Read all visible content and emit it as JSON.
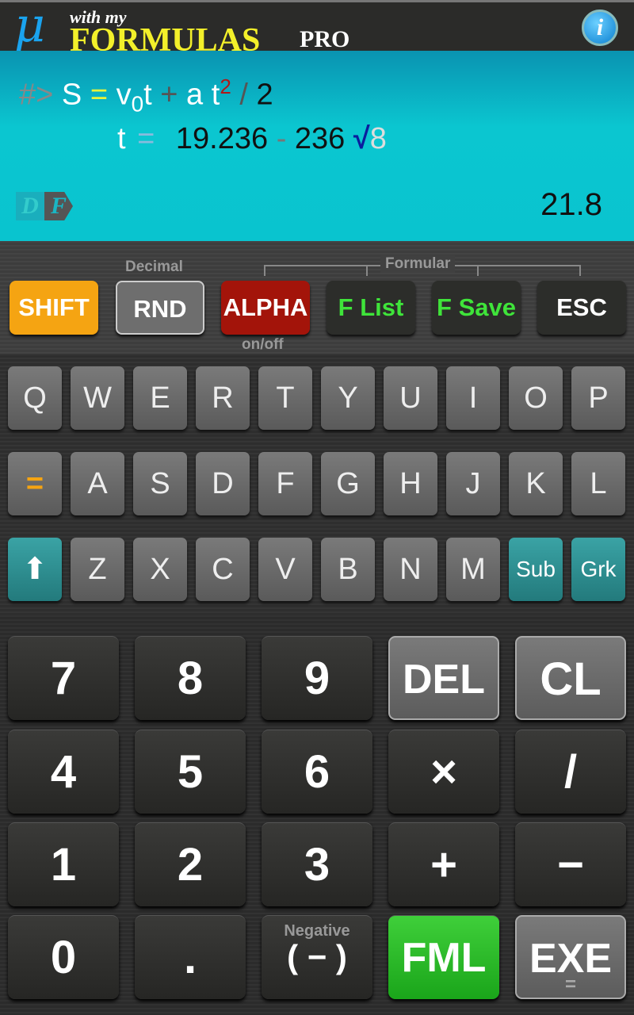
{
  "header": {
    "logo_mu": "μ",
    "logo_with": "with my",
    "logo_formulas": "FORMULAS",
    "logo_pro": "PRO",
    "info": "i"
  },
  "display": {
    "prompt": "#>",
    "formula": {
      "S": "S",
      "eq": "=",
      "v": "v",
      "sub0": "0",
      "t1": "t",
      "plus": "+",
      "a": "a",
      "t2": "t",
      "sup": "2",
      "slash": "/",
      "two": "2"
    },
    "input": {
      "var": "t",
      "eq": "=",
      "n1": "19.236",
      "minus": "-",
      "n2": "236",
      "sqrt": "√",
      "n3": "8"
    },
    "mode_d": "D",
    "mode_f": "F",
    "result": "21.8"
  },
  "function_row": {
    "label_decimal": "Decimal",
    "label_formular": "Formular",
    "label_onoff": "on/off",
    "buttons": [
      {
        "label": "SHIFT",
        "bg": "#f5a412",
        "color": "#ffffff"
      },
      {
        "label": "RND",
        "bg": "#6e6e6e",
        "color": "#ffffff"
      },
      {
        "label": "ALPHA",
        "bg": "#a3140a",
        "color": "#ffffff"
      },
      {
        "label": "F List",
        "bg": "#2c2d2a",
        "color": "#3fe43a"
      },
      {
        "label": "F Save",
        "bg": "#2c2d2a",
        "color": "#3fe43a"
      },
      {
        "label": "ESC",
        "bg": "#2c2d2a",
        "color": "#ffffff"
      }
    ]
  },
  "letters": [
    [
      "Q",
      "W",
      "E",
      "R",
      "T",
      "Y",
      "U",
      "I",
      "O",
      "P"
    ],
    [
      "=",
      "A",
      "S",
      "D",
      "F",
      "G",
      "H",
      "J",
      "K",
      "L"
    ],
    [
      "⬆",
      "Z",
      "X",
      "C",
      "V",
      "B",
      "N",
      "M",
      "Sub",
      "Grk"
    ]
  ],
  "numpad": [
    [
      "7",
      "8",
      "9",
      "DEL",
      "CL"
    ],
    [
      "4",
      "5",
      "6",
      "×",
      "/"
    ],
    [
      "1",
      "2",
      "3",
      "+",
      "−"
    ],
    [
      "0",
      ".",
      "( − )",
      "FML",
      "EXE"
    ]
  ],
  "numpad_negative_label": "Negative",
  "exe_sub": "="
}
